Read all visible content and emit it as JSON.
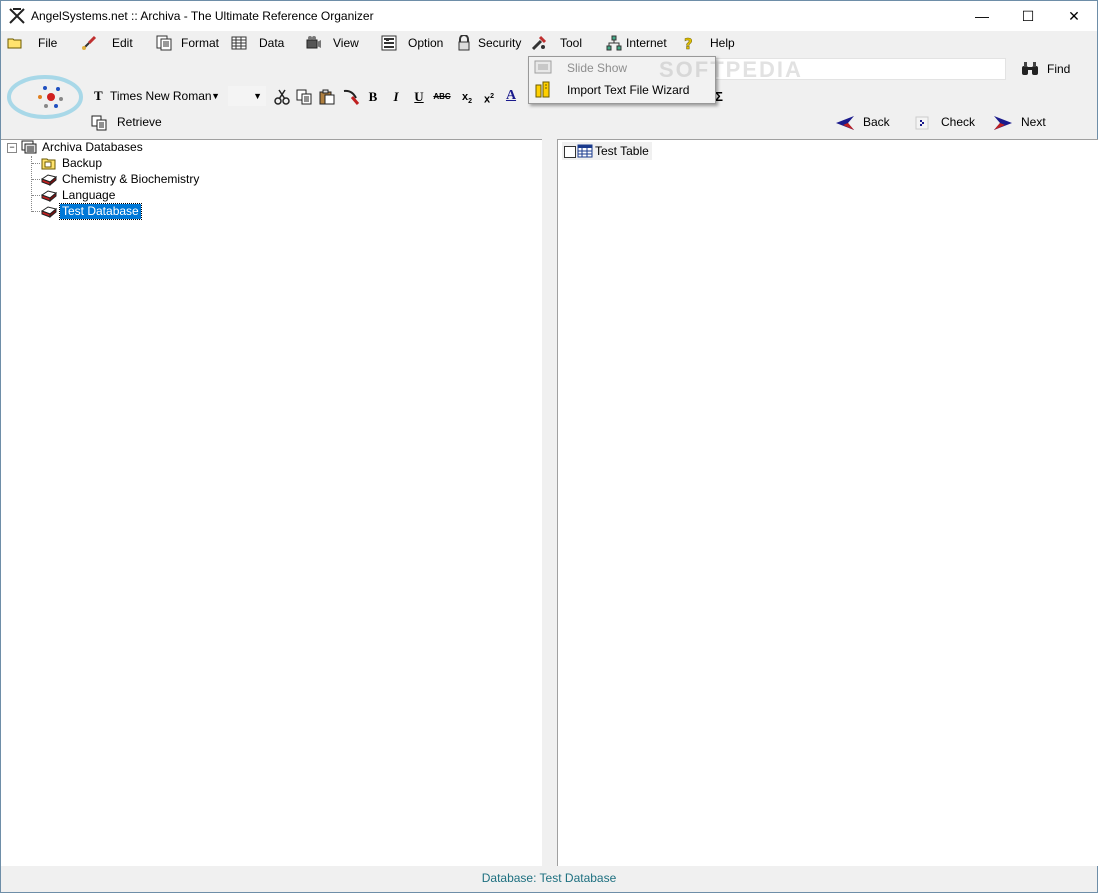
{
  "window": {
    "title": "AngelSystems.net :: Archiva - The Ultimate Reference Organizer",
    "minimize_glyph": "—",
    "maximize_glyph": "☐",
    "close_glyph": "✕"
  },
  "menubar": {
    "items": [
      {
        "label": "File",
        "icon": "folder-icon"
      },
      {
        "label": "Edit",
        "icon": "brush-icon"
      },
      {
        "label": "Format",
        "icon": "format-icon"
      },
      {
        "label": "Data",
        "icon": "grid-icon"
      },
      {
        "label": "View",
        "icon": "camera-icon"
      },
      {
        "label": "Option",
        "icon": "options-icon"
      },
      {
        "label": "Security",
        "icon": "lock-icon"
      },
      {
        "label": "Tool",
        "icon": "tools-icon"
      },
      {
        "label": "Internet",
        "icon": "network-icon"
      },
      {
        "label": "Help",
        "icon": "help-icon"
      }
    ]
  },
  "tool_menu": {
    "items": [
      {
        "label": "Slide Show",
        "enabled": false,
        "icon": "slideshow-icon"
      },
      {
        "label": "Import Text File Wizard",
        "enabled": true,
        "icon": "wizard-icon"
      }
    ]
  },
  "toolbar": {
    "find_label": "Find",
    "font_name": "Times New Roman",
    "font_size": "",
    "retrieve_label": "Retrieve",
    "back_label": "Back",
    "check_label": "Check",
    "next_label": "Next",
    "bold_glyph": "B",
    "italic_glyph": "I",
    "underline_glyph": "U",
    "strike_glyph": "ABC",
    "subscript_glyph": "x",
    "superscript_glyph": "x",
    "font_color_glyph": "A",
    "sum_glyph": "Σ",
    "font_glyph": "T"
  },
  "tree": {
    "root": {
      "label": "Archiva Databases",
      "expanded": true
    },
    "children": [
      {
        "label": "Backup",
        "icon": "folder-icon"
      },
      {
        "label": "Chemistry & Biochemistry",
        "icon": "database-icon"
      },
      {
        "label": "Language",
        "icon": "database-icon"
      },
      {
        "label": "Test Database",
        "icon": "database-icon",
        "selected": true
      }
    ]
  },
  "tables": {
    "items": [
      {
        "label": "Test Table",
        "checked": false
      }
    ]
  },
  "status": {
    "text": "Database: Test Database"
  },
  "watermark": "SOFTPEDIA",
  "colors": {
    "selection": "#0078d7",
    "status_text": "#1e7080",
    "nav_arrow": "#1a1a8c"
  }
}
